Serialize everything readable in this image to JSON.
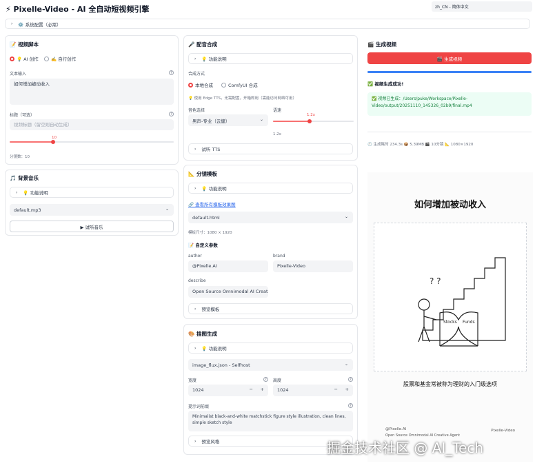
{
  "app_title": "⚡ Pixelle-Video - AI 全自动短视频引擎",
  "language_select": "zh_CN - 简体中文",
  "system_config": "⚙️ 系统配置（必需）",
  "script": {
    "title": "📝 视频脚本",
    "mode_ai": "💡 AI 创作",
    "mode_custom": "✍️ 自行创作",
    "text_label": "文本输入",
    "text_value": "如何增加被动收入",
    "caption_label": "标题（可选）",
    "caption_placeholder": "视频标题（留空则自动生成）",
    "slider_value": "10",
    "scenes_label": "分镜数：10"
  },
  "bgm": {
    "title": "🎵 背景音乐",
    "help": "💡 功能说明",
    "selected": "default.mp3",
    "preview_button": "▶ 试听音乐"
  },
  "tts": {
    "title": "🎤 配音合成",
    "help": "💡 功能说明",
    "method_label": "合成方式",
    "local": "本地合成",
    "comfy": "ComfyUI 合成",
    "hint": "💡 使用 Edge TTS，无需配置，开箱即用（需能访问网络可用）",
    "voice_label": "音色选择",
    "voice_value": "男声-专业（云健）",
    "speed_label": "语速",
    "speed_value": "1.2x",
    "speed_min": "1.2x",
    "speed_level": 0.45,
    "preview": "试听 TTS"
  },
  "storyboard": {
    "title": "📐 分镜模板",
    "help": "💡 功能说明",
    "preview_link": "🔗 查看所有模板效果图",
    "template": "default.html",
    "size_label": "模板尺寸：1080 × 1920",
    "custom_title": "📝 自定义参数",
    "author_label": "author",
    "author_value": "@Pixelle.AI",
    "brand_label": "brand",
    "brand_value": "Pixelle-Video",
    "describe_label": "describe",
    "describe_value": "Open Source Omnimodal AI Creative",
    "preview": "预览模板"
  },
  "image_gen": {
    "title": "🎨 插图生成",
    "help": "💡 功能说明",
    "workflow": "image_flux.json - Selfhost",
    "width_label": "宽度",
    "width_value": "1024",
    "height_label": "高度",
    "height_value": "1024",
    "prompt_label": "提示词前缀",
    "prompt_value": "Minimalist black-and-white matchstick figure style illustration, clean lines, simple sketch style",
    "style_preview": "预览风格"
  },
  "output": {
    "title": "🎬 生成视频",
    "generate_button": "🎬 生成视频",
    "progress": 1.0,
    "success": "✅ 视频生成成功!",
    "path_text": "✅ 视频已生成：/Users/puke/Workspace/Pixelle-Video/output/20251110_145326_02b9/final.mp4",
    "stats": "🕐 生成耗时 234.3s 📦 5.39MB 🎬 10分镜 📐 1080×1920",
    "preview_title": "如何增加被动收入",
    "preview_subtitle": "股票和基金常被称为理财的入门级选项",
    "preview_author": "@Pixelle.AI",
    "preview_desc": "Open Source Omnimodal AI Creative Agent",
    "preview_brand": "Pixelle-Video",
    "book_left": "Stocks",
    "book_right": "Funds",
    "question_marks": "? ?"
  },
  "watermark": "掘金技术社区 @ AI_Tech"
}
